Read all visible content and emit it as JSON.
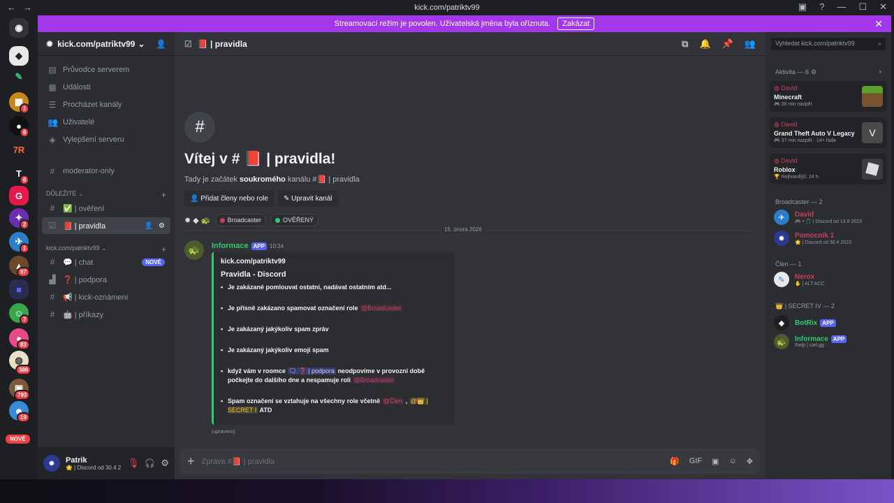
{
  "browser": {
    "url": "kick.com/patriktv99"
  },
  "banner": {
    "text": "Streamovací režim je povolen. Uživatelská jména byla oříznuta.",
    "button": "Zakázat"
  },
  "guild_badges": [
    "1",
    "6",
    "2",
    "1",
    "97",
    "7",
    "83",
    "386",
    "793",
    "19"
  ],
  "guild_new": "NOVÉ",
  "server": {
    "name": "kick.com/patriktv99"
  },
  "sidebar": {
    "nav": [
      {
        "icon": "compass-icon",
        "label": "Průvodce serverem"
      },
      {
        "icon": "calendar-icon",
        "label": "Události"
      },
      {
        "icon": "list-icon",
        "label": "Procházet kanály"
      },
      {
        "icon": "users-icon",
        "label": "Uživatelé"
      },
      {
        "icon": "boost-icon",
        "label": "Vylepšení serveru"
      }
    ],
    "channel_moderator": "moderator-only",
    "cat_important": "DŮLEŽITÉ",
    "ch_overeni": "✅ | ověření",
    "ch_pravidla": "📕 | pravidla",
    "cat_kick": "kick.com/patriktv99",
    "ch_chat": "💬 | chat",
    "ch_chat_badge": "NOVÉ",
    "ch_podpora": "❓ | podpora",
    "ch_kick": "📢 | kick-oznámení",
    "ch_prikazy": "🤖 | příkazy"
  },
  "user": {
    "name": "Patrik",
    "status": "🌟 | Discord od 30.4 2"
  },
  "channel": {
    "title": "📕 | pravidla"
  },
  "welcome": {
    "title": "Vítej v # 📕 | pravidla!",
    "sub_pre": "Tady je začátek ",
    "sub_bold": "soukromého",
    "sub_post": " kanálu #📕 | pravidla",
    "btn_add": "Přidat členy nebo role",
    "btn_edit": "Upravit kanál",
    "tag_broadcaster": "Broadcaster",
    "tag_verified": "OVĚŘENÝ",
    "colors": {
      "broadcaster": "#c9405f",
      "verified": "#2ecc71"
    }
  },
  "date_divider": "15. února 2026",
  "message": {
    "author": "Informace",
    "app": "APP",
    "time": "10:34",
    "embed_author": "kick.com/patriktv99",
    "embed_title": "Pravidla - Discord",
    "r1": "Je zakázané pomlouvat ostatní, nadávat ostatním atd...",
    "r2_pre": "Je přísně zakázano spamovat označení role ",
    "r2_mention": "@Broadcaster",
    "r3": "Je zakázaný jakýkoliv spam zpráv",
    "r4": "Je zakázaný jakýkoliv emoji spam",
    "r5_pre": "když vám v roomce ",
    "r5_channel": "🗨 ❓ | podpora",
    "r5_mid": " neodpovíme v provozní době počkejte do dalšího dne a nespamuje roli ",
    "r5_mention": "@Broadcaster",
    "r6_pre": "Spam označení se vztahuje na všechny role včetně ",
    "r6_m1": "@Člen",
    "r6_sep": " , ",
    "r6_m2": "@👑 | SECRET I",
    "r6_post": " ATD",
    "edited": "(upraveno)"
  },
  "composer": {
    "placeholder": "Zpráva #📕 | pravidla"
  },
  "search": {
    "placeholder": "Vyhledat kick.com/patriktv99"
  },
  "members": {
    "activity_header": "Aktivita — 6",
    "activities": [
      {
        "who": "David",
        "game": "Minecraft",
        "time": "36 min nazpět"
      },
      {
        "who": "David",
        "game": "Grand Theft Auto V Legacy",
        "time": "37 min nazpět · 14× řada"
      },
      {
        "who": "David",
        "game": "Roblox",
        "time": "Nejhranější: 24 h"
      }
    ],
    "broadcaster_header": "Broadcaster — 2",
    "broadcasters": [
      {
        "name": "David",
        "status": "🎮 • 🎵 | Discord od 13.8 2023"
      },
      {
        "name": "Pomocník 1",
        "status": "🌟 | Discord od 30.4 2023"
      }
    ],
    "member_header": "Člen — 1",
    "member": {
      "name": "Nerox",
      "status": "✋ | ALT ACC"
    },
    "secret_header": "👑 | SECRET IV — 2",
    "bots": [
      {
        "name": "BotRix",
        "app": "APP",
        "status": ""
      },
      {
        "name": "Informace",
        "app": "APP",
        "status": "/help | carl.gg"
      }
    ],
    "colors": {
      "broadcaster": "#c9405f",
      "bot": "#2ecc71"
    }
  }
}
